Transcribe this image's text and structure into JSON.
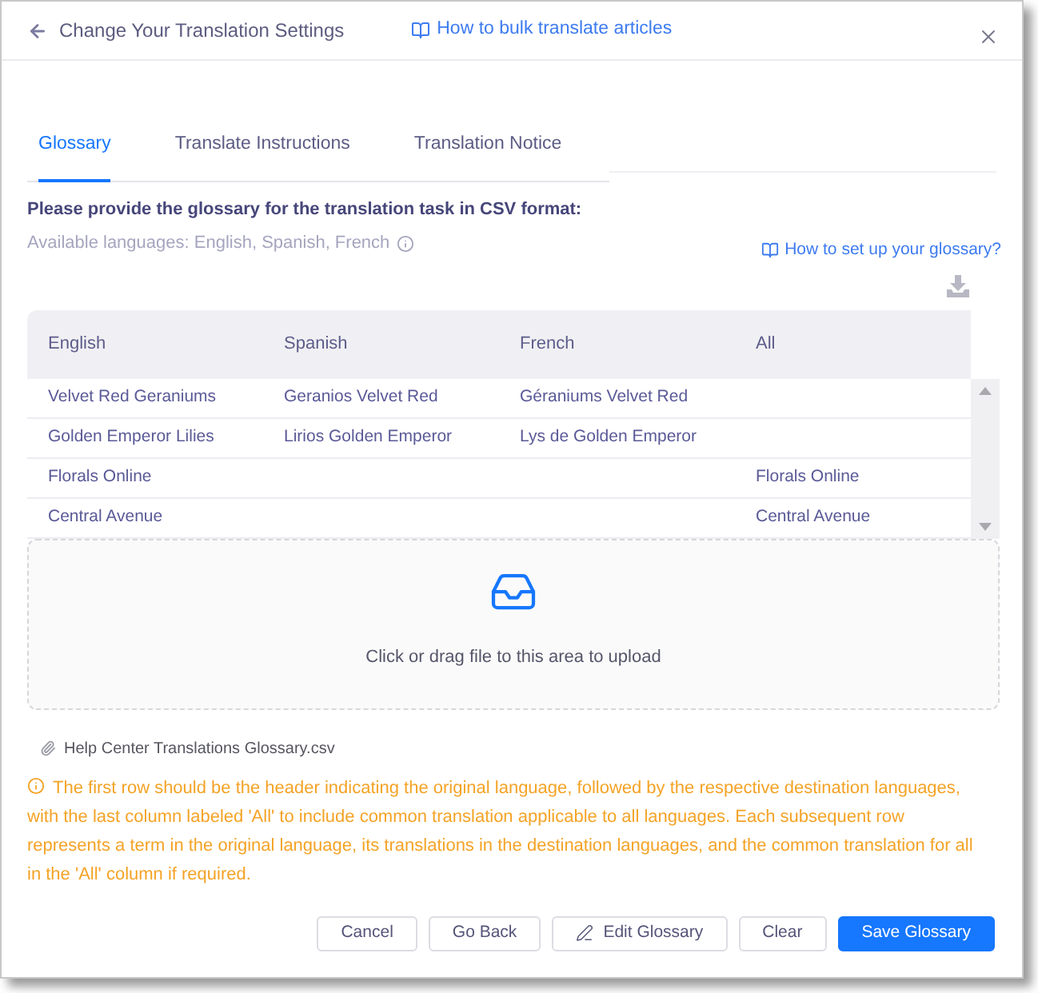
{
  "dialog": {
    "title": "Change Your Translation Settings",
    "help_link": "How to bulk translate articles"
  },
  "tabs": [
    {
      "label": "Glossary",
      "selected": true
    },
    {
      "label": "Translate Instructions",
      "selected": false
    },
    {
      "label": "Translation Notice",
      "selected": false
    }
  ],
  "glossary": {
    "heading": "Please provide the glossary for the translation task in CSV format:",
    "languages_note": "Available languages: English, Spanish, French",
    "setup_link": "How to set up your glossary?"
  },
  "table": {
    "columns": [
      "English",
      "Spanish",
      "French",
      "All"
    ],
    "rows": [
      [
        "Velvet Red Geraniums",
        "Geranios Velvet Red",
        "Géraniums Velvet Red",
        null
      ],
      [
        "Golden Emperor Lilies",
        "Lirios Golden Emperor",
        "Lys de Golden Emperor",
        null
      ],
      [
        "Florals Online",
        null,
        null,
        "Florals Online"
      ],
      [
        "Central Avenue",
        null,
        null,
        "Central Avenue"
      ]
    ]
  },
  "upload": {
    "prompt": "Click or drag file to this area to upload"
  },
  "attachment": {
    "file_name": "Help Center Translations Glossary.csv"
  },
  "notice": "The first row should be the header indicating the original language, followed by the respective destination languages, with the last column labeled 'All' to include common translation applicable to all languages. Each subsequent row represents a term in the original language, its translations in the destination languages, and the common translation for all in the 'All' column if required.",
  "buttons": [
    {
      "label": "Cancel",
      "kind": "plain"
    },
    {
      "label": "Go Back",
      "kind": "plain"
    },
    {
      "label": "Edit Glossary",
      "kind": "edit"
    },
    {
      "label": "Clear",
      "kind": "plain"
    },
    {
      "label": "Save Glossary",
      "kind": "primary"
    }
  ]
}
